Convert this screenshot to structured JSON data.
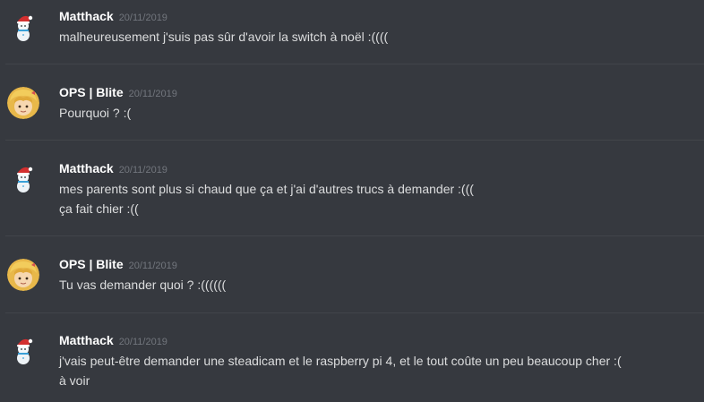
{
  "messages": [
    {
      "author": "Matthack",
      "avatar": "snowman-santa-hat",
      "timestamp": "20/11/2019",
      "lines": [
        "malheureusement j'suis pas sûr d'avoir la switch à noël :(((("
      ]
    },
    {
      "author": "OPS | Blite",
      "avatar": "blonde-character",
      "timestamp": "20/11/2019",
      "lines": [
        "Pourquoi ? :("
      ]
    },
    {
      "author": "Matthack",
      "avatar": "snowman-santa-hat",
      "timestamp": "20/11/2019",
      "lines": [
        "mes parents sont plus si chaud que ça et j'ai d'autres trucs à demander :(((",
        "ça fait chier :(("
      ]
    },
    {
      "author": "OPS | Blite",
      "avatar": "blonde-character",
      "timestamp": "20/11/2019",
      "lines": [
        "Tu vas demander quoi ? :(((((("
      ]
    },
    {
      "author": "Matthack",
      "avatar": "snowman-santa-hat",
      "timestamp": "20/11/2019",
      "lines": [
        "j'vais peut-être demander une steadicam et le raspberry pi 4, et le tout coûte un peu beaucoup cher :(",
        "à voir"
      ]
    }
  ],
  "colors": {
    "background": "#36393f",
    "username": "#ffffff",
    "text": "#dcddde",
    "timestamp": "#72767d",
    "divider": "#42454a"
  }
}
